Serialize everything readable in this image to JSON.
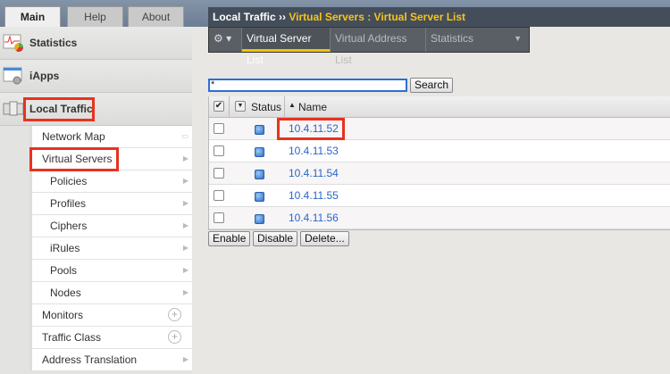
{
  "main_tabs": [
    "Main",
    "Help",
    "About"
  ],
  "sidebar": {
    "sections": [
      "Statistics",
      "iApps",
      "Local Traffic"
    ],
    "submenu": [
      {
        "label": "Network Map",
        "marker": "map"
      },
      {
        "label": "Virtual Servers",
        "marker": "arrow"
      },
      {
        "label": "Policies",
        "marker": "arrow"
      },
      {
        "label": "Profiles",
        "marker": "arrow"
      },
      {
        "label": "Ciphers",
        "marker": "arrow"
      },
      {
        "label": "iRules",
        "marker": "arrow"
      },
      {
        "label": "Pools",
        "marker": "arrow"
      },
      {
        "label": "Nodes",
        "marker": "arrow"
      },
      {
        "label": "Monitors",
        "marker": "plus"
      },
      {
        "label": "Traffic Class",
        "marker": "plus"
      },
      {
        "label": "Address Translation",
        "marker": "arrow"
      }
    ]
  },
  "header": {
    "section": "Local Traffic",
    "sep": "››",
    "path": "Virtual Servers : Virtual Server List"
  },
  "tabs": [
    "Virtual Server List",
    "Virtual Address List",
    "Statistics"
  ],
  "search": {
    "value": "*",
    "button": "Search"
  },
  "table": {
    "columns": [
      "Status",
      "Name"
    ],
    "sort_indicator": "▲",
    "rows": [
      "10.4.11.52",
      "10.4.11.53",
      "10.4.11.54",
      "10.4.11.55",
      "10.4.11.56"
    ]
  },
  "actions": [
    "Enable",
    "Disable",
    "Delete..."
  ],
  "highlight_color": "#e8321f"
}
